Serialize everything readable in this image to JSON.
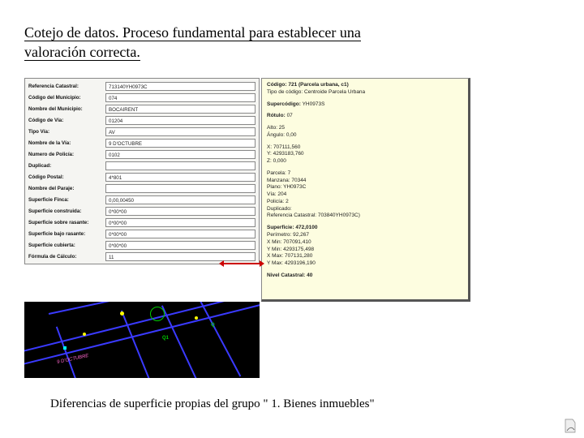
{
  "title_line1": "Cotejo de datos. Proceso fundamental para establecer una",
  "title_line2": "valoración correcta.",
  "form": {
    "rows": [
      {
        "label": "Referencia Catastral:",
        "value": "713140YH0973C"
      },
      {
        "label": "Código del Municipio:",
        "value": "074"
      },
      {
        "label": "Nombre del Municipio:",
        "value": "BOCAIRENT"
      },
      {
        "label": "Código de Vía:",
        "value": "01204"
      },
      {
        "label": "Tipo Vía:",
        "value": "AV"
      },
      {
        "label": "Nombre de la Vía:",
        "value": "9 D'OCTUBRE"
      },
      {
        "label": "Numero de Policía:",
        "value": "0102"
      },
      {
        "label": "Duplicad:",
        "value": ""
      },
      {
        "label": "Código Postal:",
        "value": "4*801"
      },
      {
        "label": "Nombre del Paraje:",
        "value": ""
      },
      {
        "label": "Superficie Finca:",
        "value": "0,00,00450"
      },
      {
        "label": "Superficie construida:",
        "value": "0*00*00"
      },
      {
        "label": "Superficie sobre rasante:",
        "value": "0*00*00"
      },
      {
        "label": "Superficie bajo rasante:",
        "value": "0*00*00"
      },
      {
        "label": "Superficie cubierta:",
        "value": "0*00*00"
      },
      {
        "label": "Fórmula de Cálculo:",
        "value": "11"
      }
    ]
  },
  "info": {
    "header1": "Código: 721 (Parcela urbana, c1)",
    "header2": "Tipo de código: Centroide Parcela Urbana",
    "super_lbl": "Supercódigo:",
    "super_val": "YH0973S",
    "rotulo_lbl": "Rótulo:",
    "rotulo_val": "07",
    "alto": "Alto: 25",
    "angulo": "Ángulo: 0,00",
    "x": "X: 707111,560",
    "y": "Y: 4293183,760",
    "z": "Z: 0,000",
    "parcela": "Parcela: 7",
    "manzana": "Manzana: 70344",
    "plano": "Plano: YH0973C",
    "via": "Vía: 204",
    "policia": "Policía: 2",
    "duplicado": "Duplicado:",
    "refcat": "Referencia Catastral: 703840YH0973C)",
    "sup_lbl": "Superficie: 472,0100",
    "per": "Perímetro: 92,267",
    "xmin": "X Min: 707091,410",
    "ymin": "Y Min: 4293175,498",
    "xmax": "X Max: 707131,280",
    "ymax": "Y Max: 4293196,190",
    "nivel": "Nivel Catastral: 40"
  },
  "map": {
    "label_green": "Q1",
    "label_pink": "9  D'OCTUBRE"
  },
  "caption": "Diferencias de superficie propias del grupo \" 1. Bienes inmuebles\""
}
